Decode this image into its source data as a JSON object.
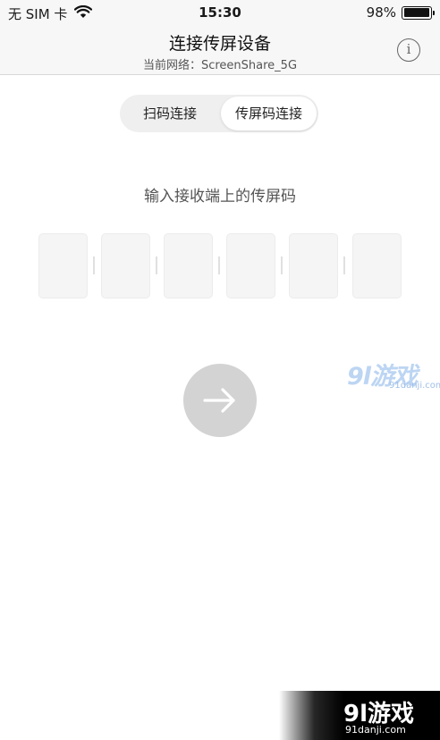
{
  "status_bar": {
    "carrier": "无 SIM 卡",
    "time": "15:30",
    "battery": "98%",
    "battery_level": 0.98
  },
  "nav": {
    "title": "连接传屏设备",
    "subtitle": "当前网络：ScreenShare_5G",
    "info_label": "i"
  },
  "segmented": {
    "options": [
      {
        "label": "扫码连接",
        "selected": false
      },
      {
        "label": "传屏码连接",
        "selected": true
      }
    ]
  },
  "main": {
    "instruction": "输入接收端上的传屏码",
    "code_digits": [
      "",
      "",
      "",
      "",
      "",
      ""
    ]
  },
  "watermarks": {
    "middle_logo": "9l游戏",
    "middle_url": "91danji.com",
    "corner_logo": "9l游戏",
    "corner_url": "91danji.com"
  },
  "colors": {
    "accent_disabled": "#d3d3d3",
    "nav_background": "#f7f7f7"
  }
}
